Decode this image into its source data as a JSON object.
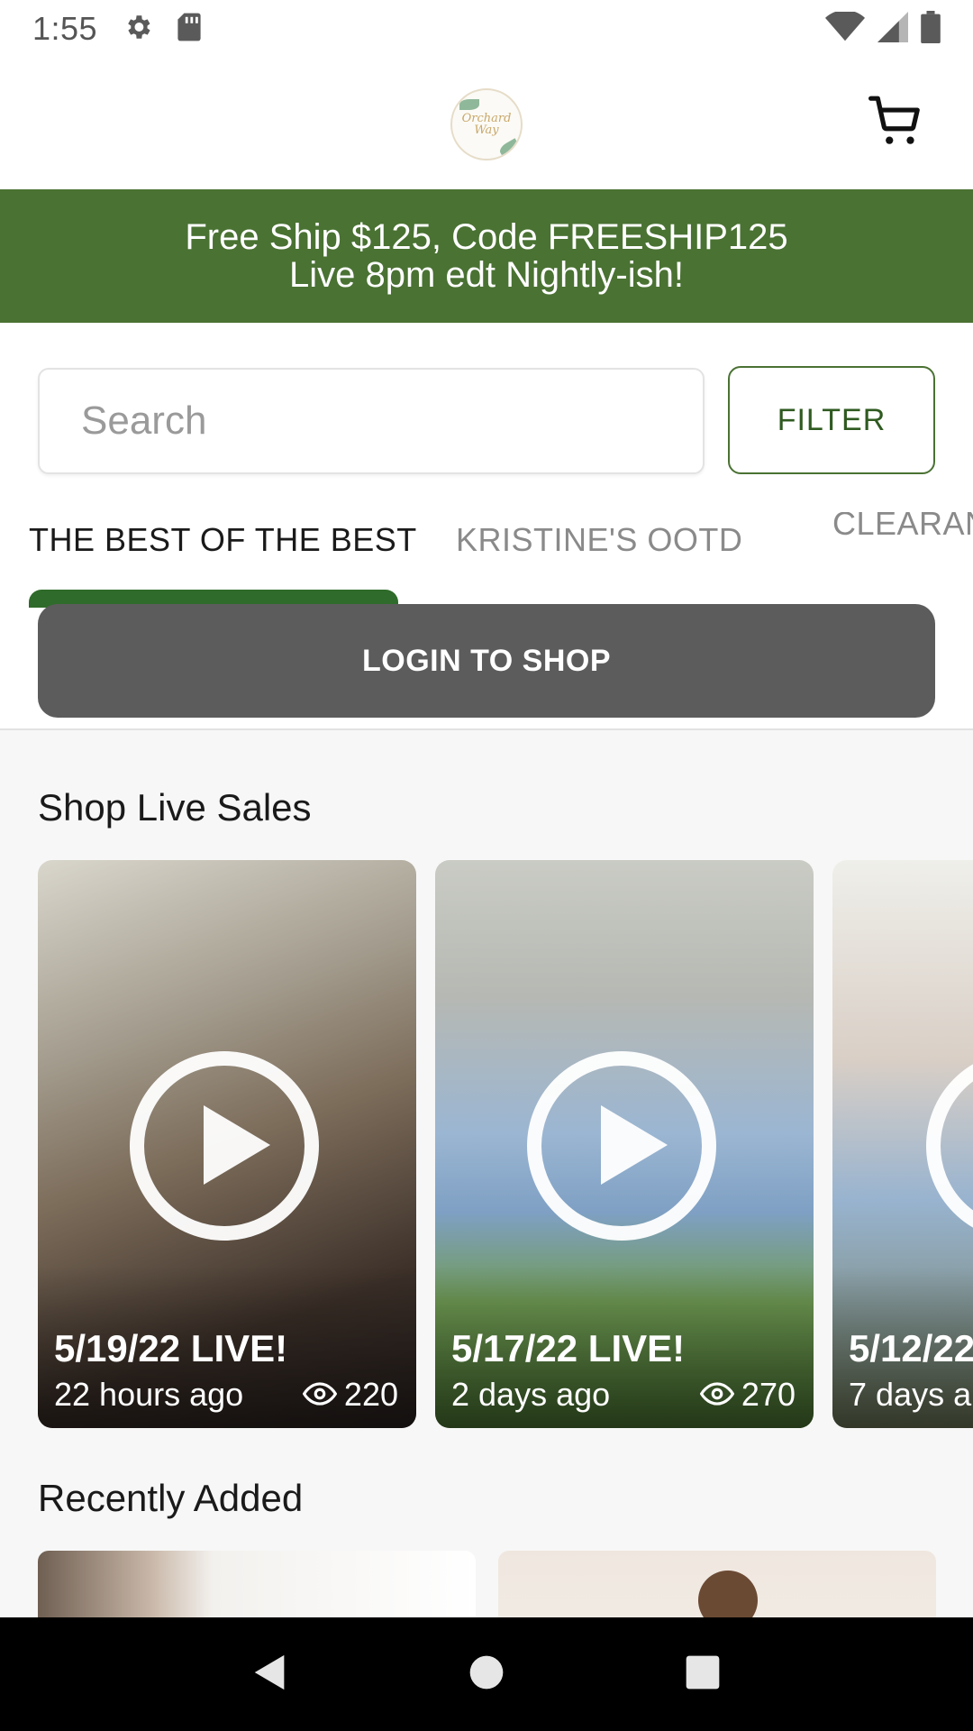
{
  "status_bar": {
    "time": "1:55"
  },
  "header": {
    "logo_text": "Orchard Way",
    "cart_icon": "cart-icon"
  },
  "promo": {
    "line1": "Free Ship $125, Code FREESHIP125",
    "line2": "Live 8pm edt Nightly-ish!",
    "background": "#4a7233"
  },
  "search": {
    "placeholder": "Search",
    "filter_label": "FILTER"
  },
  "tabs": [
    {
      "label": "THE BEST OF THE BEST",
      "active": true
    },
    {
      "label": "KRISTINE'S OOTD",
      "active": false
    },
    {
      "label": "CLEARAN",
      "active": false
    }
  ],
  "login": {
    "label": "LOGIN TO SHOP"
  },
  "live_sales": {
    "title": "Shop Live Sales",
    "cards": [
      {
        "date": "5/19/22 LIVE!",
        "ago": "22 hours ago",
        "views": "220"
      },
      {
        "date": "5/17/22 LIVE!",
        "ago": "2 days ago",
        "views": "270"
      },
      {
        "date": "5/12/22",
        "ago": "7 days a"
      }
    ]
  },
  "recently_added": {
    "title": "Recently Added"
  },
  "colors": {
    "accent_green": "#4a7233",
    "login_gray": "#5c5c5c"
  }
}
